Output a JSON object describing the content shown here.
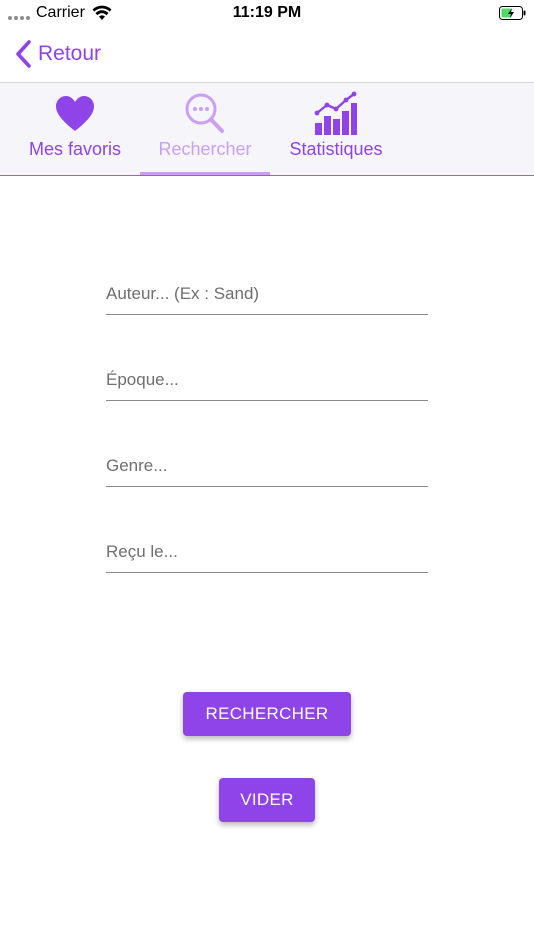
{
  "status_bar": {
    "carrier": "Carrier",
    "time": "11:19 PM",
    "icons": [
      "signal-dots-icon",
      "wifi-icon",
      "battery-charging-icon"
    ]
  },
  "navbar": {
    "back_label": "Retour",
    "back_icon": "chevron-left-icon"
  },
  "tabs": [
    {
      "label": "Mes favoris",
      "icon": "heart-icon",
      "active": false
    },
    {
      "label": "Rechercher",
      "icon": "search-magnifier-icon",
      "active": true
    },
    {
      "label": "Statistiques",
      "icon": "bar-chart-icon",
      "active": false
    }
  ],
  "form": {
    "author_placeholder": "Auteur... (Ex : Sand)",
    "era_placeholder": "Époque...",
    "genre_placeholder": "Genre...",
    "received_placeholder": "Reçu le..."
  },
  "actions": {
    "search_label": "RECHERCHER",
    "clear_label": "VIDER"
  },
  "colors": {
    "accent": "#8e44e8",
    "accent_light": "#c9a0f5",
    "tabbar_bg": "#f6f5f9"
  }
}
